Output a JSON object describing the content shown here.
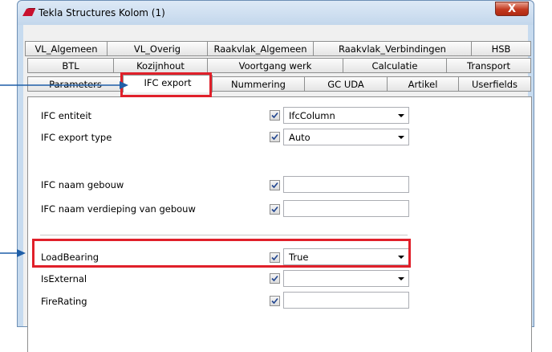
{
  "window": {
    "title": "Tekla Structures  Kolom (1)",
    "close_glyph": "X"
  },
  "tabs": {
    "row1": [
      "VL_Algemeen",
      "VL_Overig",
      "Raakvlak_Algemeen",
      "Raakvlak_Verbindingen",
      "HSB"
    ],
    "row2": [
      "BTL",
      "Kozijnhout",
      "Voortgang werk",
      "Calculatie",
      "Transport"
    ],
    "row3": [
      "Parameters",
      "IFC export",
      "Nummering",
      "GC UDA",
      "Artikel",
      "Userfields"
    ],
    "active": "IFC export"
  },
  "fields": [
    {
      "label": "IFC entiteit",
      "checked": true,
      "type": "select",
      "value": "IfcColumn"
    },
    {
      "label": "IFC export type",
      "checked": true,
      "type": "select",
      "value": "Auto"
    },
    {
      "label": "IFC naam gebouw",
      "checked": true,
      "type": "text",
      "value": ""
    },
    {
      "label": "IFC naam verdieping van gebouw",
      "checked": true,
      "type": "text",
      "value": ""
    },
    {
      "label": "LoadBearing",
      "checked": true,
      "type": "select",
      "value": "True"
    },
    {
      "label": "IsExternal",
      "checked": true,
      "type": "select",
      "value": ""
    },
    {
      "label": "FireRating",
      "checked": true,
      "type": "text",
      "value": ""
    }
  ],
  "colors": {
    "highlight": "#e0202a",
    "pointer": "#1f5fa8",
    "window_frame": "#c7dbef"
  },
  "icons": {
    "app": "tekla-icon",
    "checkbox": "checkmark-icon",
    "dropdown": "chevron-down-icon",
    "pointer": "arrow-right-icon"
  }
}
